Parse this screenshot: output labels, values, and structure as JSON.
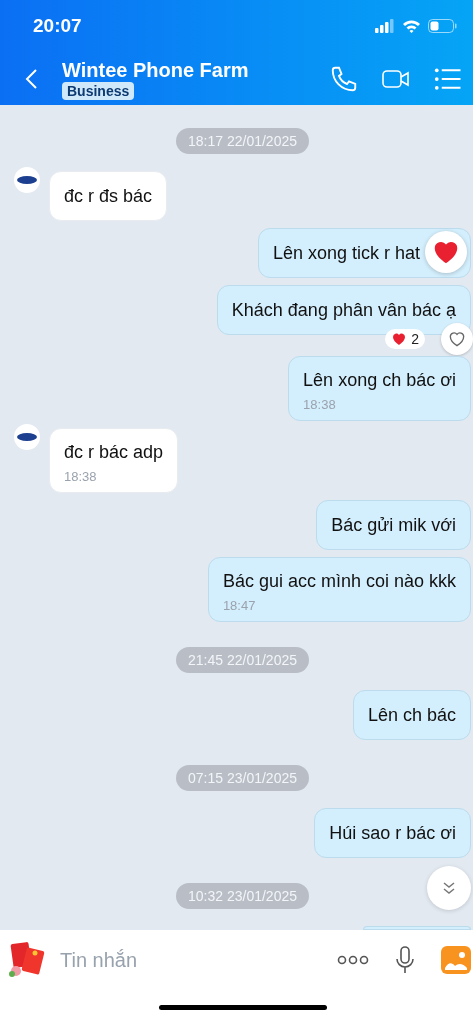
{
  "status_bar": {
    "time": "20:07"
  },
  "header": {
    "title": "Wintee Phone Farm",
    "badge": "Business"
  },
  "messages": [
    {
      "kind": "peek-top"
    },
    {
      "kind": "date",
      "text": "18:17 22/01/2025"
    },
    {
      "kind": "received",
      "text": "đc r đs bác",
      "avatar": true
    },
    {
      "kind": "sent",
      "text": "Lên xong tick r hat",
      "reacted": true
    },
    {
      "kind": "sent",
      "text": "Khách đang phân vân bác ạ",
      "reaction_count": "2"
    },
    {
      "kind": "sent",
      "text": "Lên xong ch bác ơi",
      "time": "18:38"
    },
    {
      "kind": "received",
      "text": "đc r bác adp",
      "time": "18:38",
      "avatar": true
    },
    {
      "kind": "sent",
      "text": "Bác gửi mik với"
    },
    {
      "kind": "sent",
      "text": "Bác gui acc mình coi nào kkk",
      "time": "18:47"
    },
    {
      "kind": "date",
      "text": "21:45 22/01/2025"
    },
    {
      "kind": "sent",
      "text": "Lên ch bác"
    },
    {
      "kind": "date",
      "text": "07:15 23/01/2025"
    },
    {
      "kind": "sent",
      "text": "Húi sao r bác ơi"
    },
    {
      "kind": "date",
      "text": "10:32 23/01/2025"
    },
    {
      "kind": "peek-bottom"
    }
  ],
  "composer": {
    "placeholder": "Tin nhắn"
  }
}
